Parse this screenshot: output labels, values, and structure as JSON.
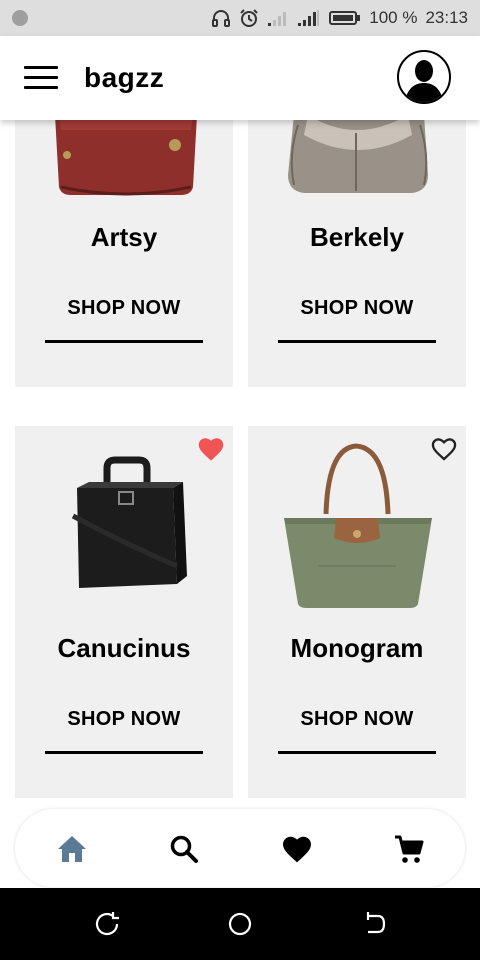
{
  "status_bar": {
    "battery_percent": "100 %",
    "time": "23:13"
  },
  "app": {
    "title": "bagzz"
  },
  "products": [
    {
      "name": "Artsy",
      "cta": "SHOP NOW",
      "favorited": false,
      "bag_color": "#8e2f2c"
    },
    {
      "name": "Berkely",
      "cta": "SHOP NOW",
      "favorited": false,
      "bag_color": "#9a9288"
    },
    {
      "name": "Canucinus",
      "cta": "SHOP NOW",
      "favorited": true,
      "bag_color": "#1c1c1c"
    },
    {
      "name": "Monogram",
      "cta": "SHOP NOW",
      "favorited": false,
      "bag_color": "#7a8a6a"
    }
  ],
  "bottom_nav": {
    "items": [
      "home",
      "search",
      "favorites",
      "cart"
    ],
    "active": "home",
    "active_color": "#5b7a95"
  },
  "colors": {
    "heart_active": "#f05454",
    "card_bg": "#f0f0f0"
  }
}
